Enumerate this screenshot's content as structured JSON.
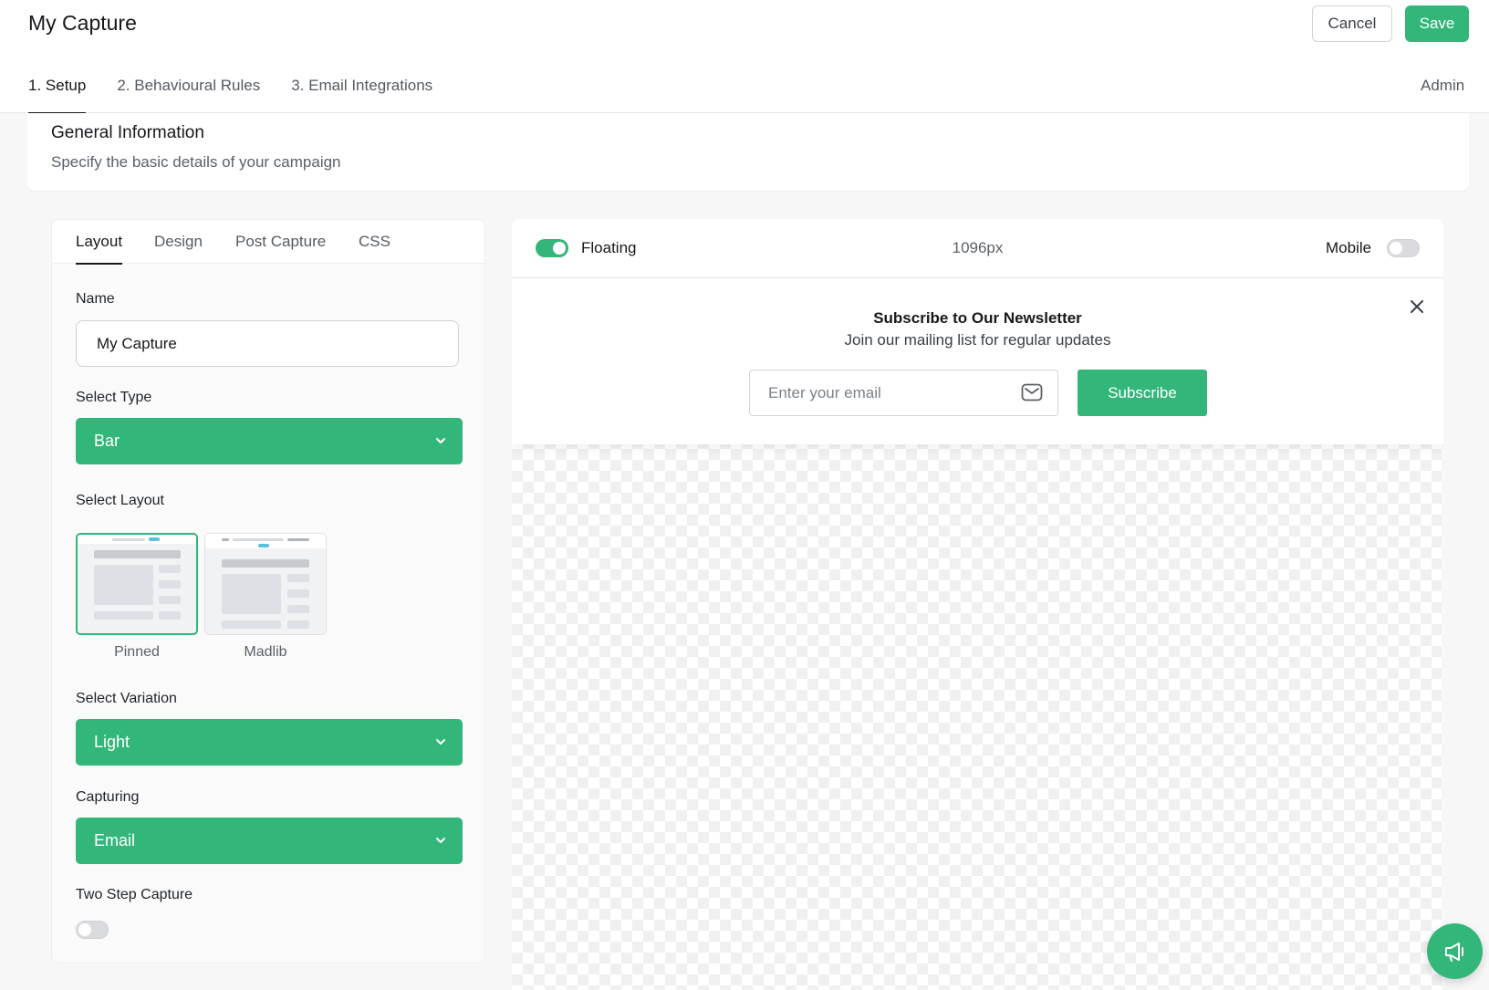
{
  "header": {
    "title": "My Capture",
    "cancel_label": "Cancel",
    "save_label": "Save",
    "admin_label": "Admin"
  },
  "main_tabs": [
    {
      "label": "1. Setup",
      "active": true
    },
    {
      "label": "2. Behavioural Rules",
      "active": false
    },
    {
      "label": "3. Email Integrations",
      "active": false
    }
  ],
  "general": {
    "title": "General Information",
    "subtitle": "Specify the basic details of your campaign"
  },
  "sub_tabs": [
    {
      "label": "Layout",
      "active": true
    },
    {
      "label": "Design",
      "active": false
    },
    {
      "label": "Post Capture",
      "active": false
    },
    {
      "label": "CSS",
      "active": false
    }
  ],
  "form": {
    "name_label": "Name",
    "name_value": "My Capture",
    "type_label": "Select Type",
    "type_value": "Bar",
    "layout_label": "Select Layout",
    "layouts": [
      {
        "label": "Pinned",
        "selected": true
      },
      {
        "label": "Madlib",
        "selected": false
      }
    ],
    "variation_label": "Select Variation",
    "variation_value": "Light",
    "capturing_label": "Capturing",
    "capturing_value": "Email",
    "two_step_label": "Two Step Capture",
    "two_step_enabled": false
  },
  "preview": {
    "floating_label": "Floating",
    "floating_enabled": true,
    "width_readout": "1096px",
    "mobile_label": "Mobile",
    "mobile_enabled": false,
    "newsletter_title": "Subscribe to Our Newsletter",
    "newsletter_subtitle": "Join our mailing list for regular updates",
    "email_placeholder": "Enter your email",
    "subscribe_label": "Subscribe"
  },
  "colors": {
    "accent": "#33b679",
    "text": "#16181b",
    "muted": "#5a6068"
  },
  "icons": {
    "chevron": "chevron-down-icon",
    "mail": "mail-icon",
    "close": "close-icon",
    "fab": "megaphone-icon"
  }
}
